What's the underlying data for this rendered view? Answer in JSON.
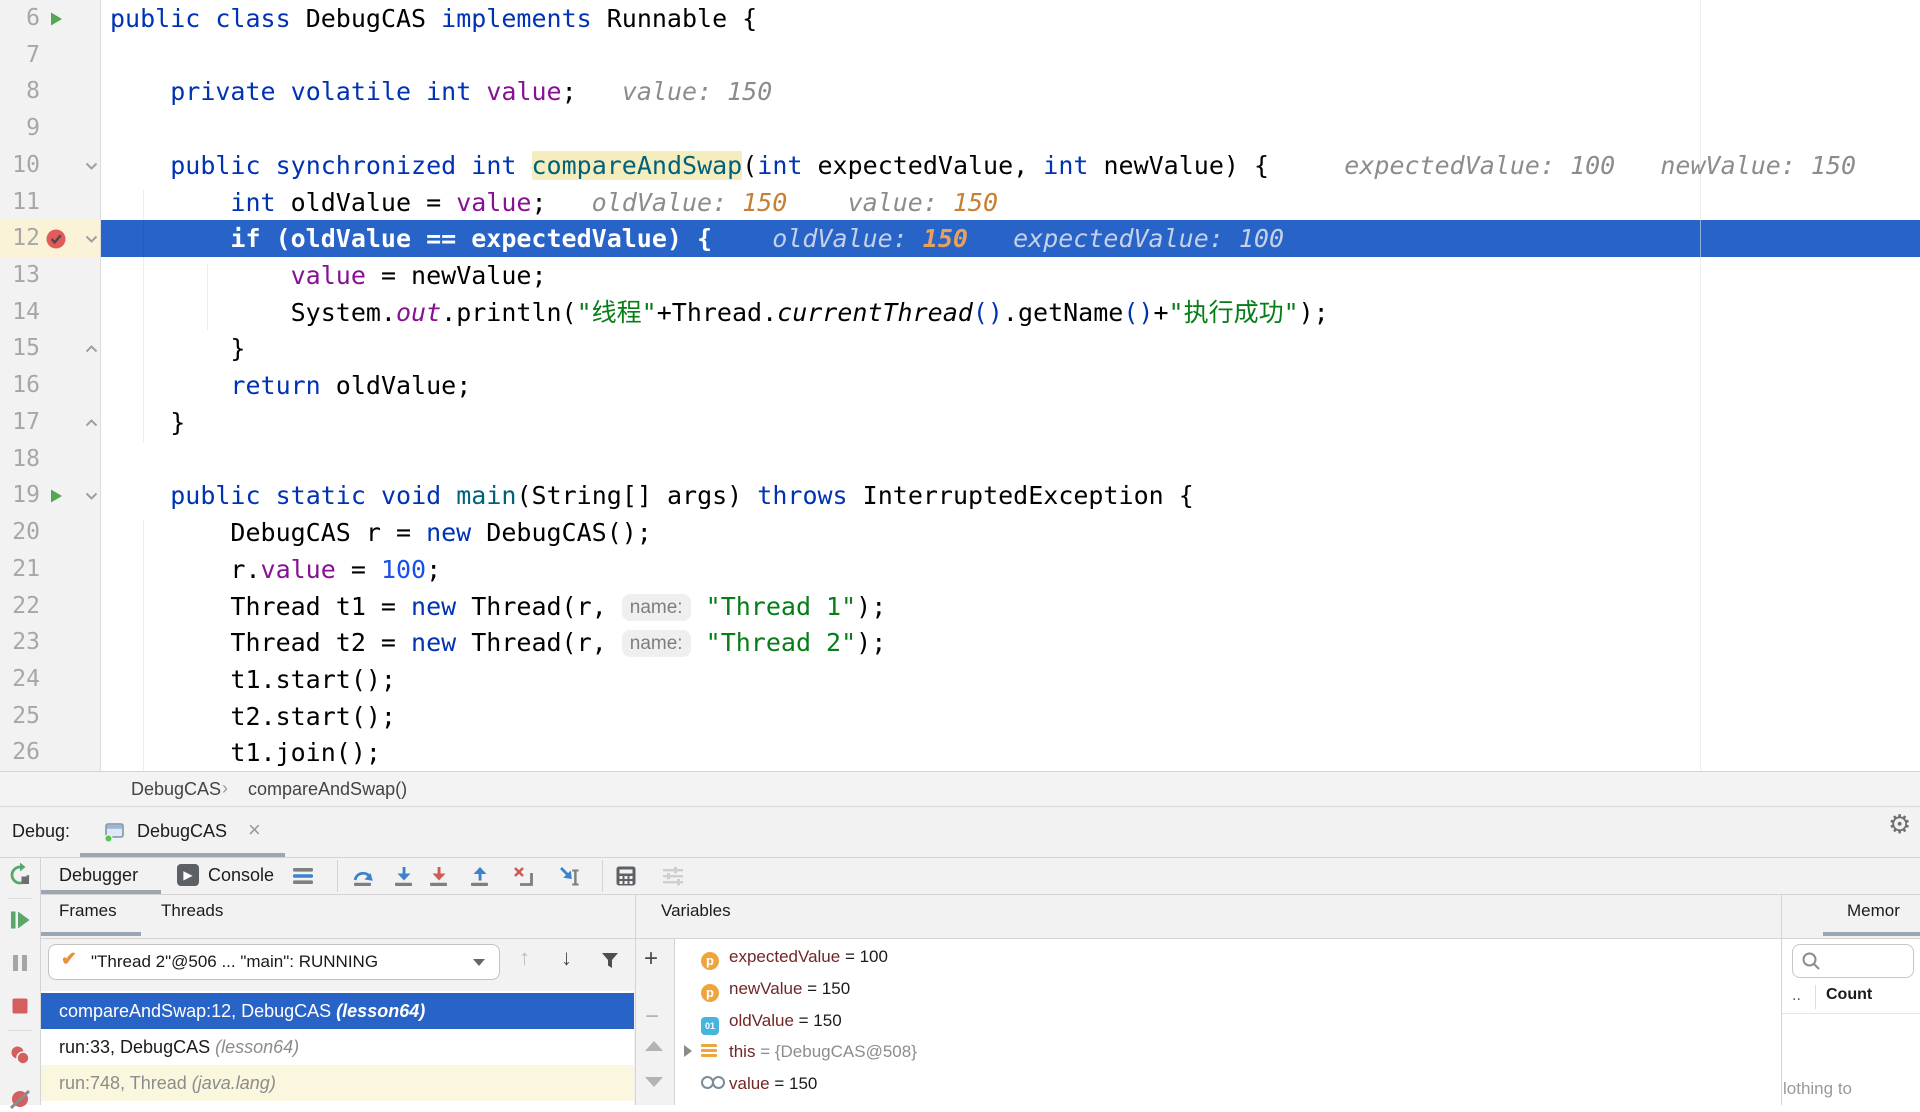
{
  "editor": {
    "lines": [
      {
        "num": "6",
        "g": [
          "run"
        ],
        "t": [
          [
            "k",
            "public"
          ],
          [
            "d",
            " "
          ],
          [
            "k",
            "class"
          ],
          [
            "d",
            " DebugCAS "
          ],
          [
            "k",
            "implements"
          ],
          [
            "d",
            " Runnable {"
          ]
        ]
      },
      {
        "num": "7",
        "t": []
      },
      {
        "num": "8",
        "t": [
          [
            "d",
            "    "
          ],
          [
            "k",
            "private"
          ],
          [
            "d",
            " "
          ],
          [
            "k",
            "volatile"
          ],
          [
            "d",
            " "
          ],
          [
            "k",
            "int"
          ],
          [
            "d",
            " "
          ],
          [
            "f",
            "value"
          ],
          [
            "d",
            ";"
          ],
          [
            "h",
            "   value: 150"
          ]
        ]
      },
      {
        "num": "9",
        "t": []
      },
      {
        "num": "10",
        "g": [
          "folddown"
        ],
        "t": [
          [
            "d",
            "    "
          ],
          [
            "k",
            "public"
          ],
          [
            "d",
            " "
          ],
          [
            "k",
            "synchronized"
          ],
          [
            "d",
            " "
          ],
          [
            "k",
            "int"
          ],
          [
            "d",
            " "
          ],
          [
            "mh",
            "compareAndSwap"
          ],
          [
            "d",
            "("
          ],
          [
            "k",
            "int"
          ],
          [
            "d",
            " expectedValue, "
          ],
          [
            "k",
            "int"
          ],
          [
            "d",
            " newValue) {"
          ],
          [
            "h",
            "     expectedValue: 100   newValue: 150"
          ]
        ]
      },
      {
        "num": "11",
        "t": [
          [
            "d",
            "        "
          ],
          [
            "k",
            "int"
          ],
          [
            "d",
            " oldValue = "
          ],
          [
            "f",
            "value"
          ],
          [
            "d",
            ";"
          ],
          [
            "h",
            "   oldValue: "
          ],
          [
            "hn",
            "150"
          ],
          [
            "h",
            "    value: "
          ],
          [
            "hn",
            "150"
          ]
        ]
      },
      {
        "num": "12",
        "sel": true,
        "g": [
          "bp",
          "folddown"
        ],
        "t": [
          [
            "w",
            "        if (oldValue == expectedValue) {"
          ],
          [
            "hw",
            "    oldValue: "
          ],
          [
            "ho",
            "150"
          ],
          [
            "hw",
            "   expectedValue: 100"
          ]
        ]
      },
      {
        "num": "13",
        "t": [
          [
            "d",
            "            "
          ],
          [
            "f",
            "value"
          ],
          [
            "d",
            " = newValue;"
          ]
        ]
      },
      {
        "num": "14",
        "t": [
          [
            "d",
            "            System."
          ],
          [
            "fi",
            "out"
          ],
          [
            "d",
            ".println("
          ],
          [
            "s",
            "\"线程\""
          ],
          [
            "d",
            "+Thread."
          ],
          [
            "it",
            "currentThread"
          ],
          [
            "b",
            "()"
          ],
          [
            "d",
            ".getName"
          ],
          [
            "b",
            "()"
          ],
          [
            "d",
            "+"
          ],
          [
            "s",
            "\"执行成功\""
          ],
          [
            "d",
            ");"
          ]
        ]
      },
      {
        "num": "15",
        "g": [
          "foldup"
        ],
        "t": [
          [
            "d",
            "        }"
          ]
        ]
      },
      {
        "num": "16",
        "t": [
          [
            "d",
            "        "
          ],
          [
            "k",
            "return"
          ],
          [
            "d",
            " oldValue;"
          ]
        ]
      },
      {
        "num": "17",
        "g": [
          "foldup"
        ],
        "t": [
          [
            "d",
            "    }"
          ]
        ]
      },
      {
        "num": "18",
        "t": []
      },
      {
        "num": "19",
        "g": [
          "run",
          "folddown"
        ],
        "t": [
          [
            "d",
            "    "
          ],
          [
            "k",
            "public"
          ],
          [
            "d",
            " "
          ],
          [
            "k",
            "static"
          ],
          [
            "d",
            " "
          ],
          [
            "k",
            "void"
          ],
          [
            "d",
            " "
          ],
          [
            "m",
            "main"
          ],
          [
            "d",
            "(String[] args) "
          ],
          [
            "k",
            "throws"
          ],
          [
            "d",
            " InterruptedException {"
          ]
        ]
      },
      {
        "num": "20",
        "t": [
          [
            "d",
            "        DebugCAS r = "
          ],
          [
            "k",
            "new"
          ],
          [
            "d",
            " DebugCAS();"
          ]
        ]
      },
      {
        "num": "21",
        "t": [
          [
            "d",
            "        r."
          ],
          [
            "f",
            "value"
          ],
          [
            "d",
            " = "
          ],
          [
            "n",
            "100"
          ],
          [
            "d",
            ";"
          ]
        ]
      },
      {
        "num": "22",
        "t": [
          [
            "d",
            "        Thread t1 = "
          ],
          [
            "k",
            "new"
          ],
          [
            "d",
            " Thread(r, "
          ],
          [
            "chip",
            "name:"
          ],
          [
            "d",
            " "
          ],
          [
            "s",
            "\"Thread 1\""
          ],
          [
            "d",
            ");"
          ]
        ]
      },
      {
        "num": "23",
        "t": [
          [
            "d",
            "        Thread t2 = "
          ],
          [
            "k",
            "new"
          ],
          [
            "d",
            " Thread(r, "
          ],
          [
            "chip",
            "name:"
          ],
          [
            "d",
            " "
          ],
          [
            "s",
            "\"Thread 2\""
          ],
          [
            "d",
            ");"
          ]
        ]
      },
      {
        "num": "24",
        "t": [
          [
            "d",
            "        t1.start();"
          ]
        ]
      },
      {
        "num": "25",
        "t": [
          [
            "d",
            "        t2.start();"
          ]
        ]
      },
      {
        "num": "26",
        "t": [
          [
            "d",
            "        t1.join();"
          ]
        ]
      }
    ]
  },
  "breadcrumb": {
    "class_item": "DebugCAS",
    "separator": "›",
    "method_item": "compareAndSwap()"
  },
  "debug_bar": {
    "label": "Debug:",
    "tab_label": "DebugCAS",
    "close": "×"
  },
  "toolbar": {
    "debugger_tab": "Debugger",
    "console_tab": "Console"
  },
  "frames_panel": {
    "tab_frames": "Frames",
    "tab_threads": "Threads",
    "thread_selector": "\"Thread 2\"@506 ... \"main\": RUNNING",
    "frames": [
      {
        "text": "compareAndSwap:12, DebugCAS ",
        "loc": "(lesson64)",
        "state": "selected"
      },
      {
        "text": "run:33, DebugCAS ",
        "loc": "(lesson64)",
        "state": "normal"
      },
      {
        "text": "run:748, Thread ",
        "loc": "(java.lang)",
        "state": "library"
      }
    ]
  },
  "variables_panel": {
    "title": "Variables",
    "variables": [
      {
        "icon": "parameter",
        "name": "expectedValue",
        "eq": " = ",
        "value": "100",
        "muted": false,
        "expandable": false
      },
      {
        "icon": "parameter",
        "name": "newValue",
        "eq": " = ",
        "value": "150",
        "muted": false,
        "expandable": false
      },
      {
        "icon": "primitive",
        "name": "oldValue",
        "eq": " = ",
        "value": "150",
        "muted": false,
        "expandable": false
      },
      {
        "icon": "object",
        "name": "this",
        "eq": " = ",
        "value": "{DebugCAS@508}",
        "muted": true,
        "expandable": true
      },
      {
        "icon": "field",
        "name": "value",
        "eq": " = ",
        "value": "150",
        "muted": false,
        "expandable": false
      }
    ]
  },
  "memory_panel": {
    "title": "Memor",
    "col_truncated": "..",
    "col_count": "Count",
    "empty_text": "lothing to"
  },
  "colors": {
    "accent_blue": "#2864C8",
    "breakpoint_red": "#E25A5A",
    "run_green": "#53A653",
    "hint_orange": "#C77F33",
    "tab_underline": "#9AA7B3"
  }
}
